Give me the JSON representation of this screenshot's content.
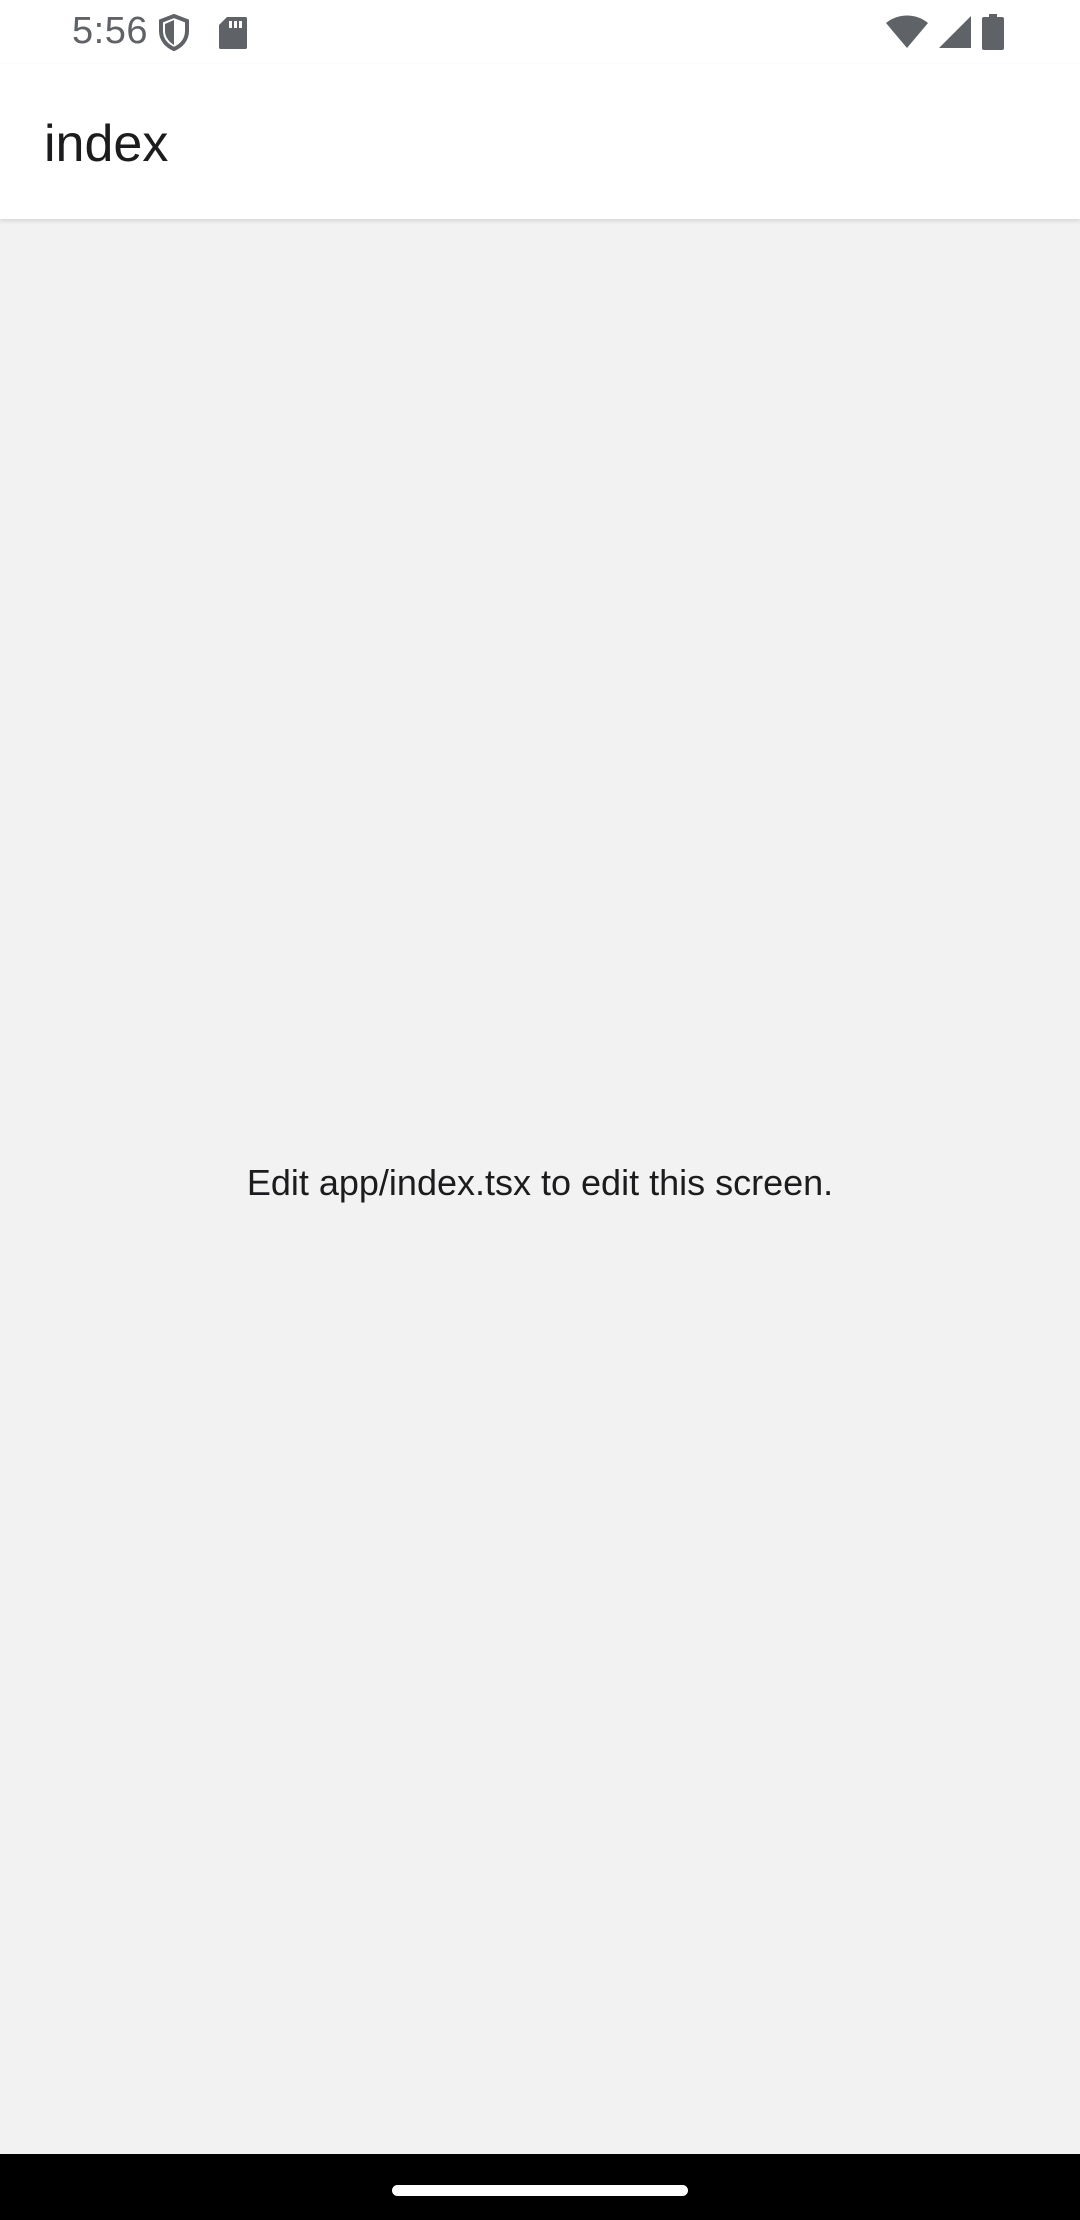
{
  "status_bar": {
    "time": "5:56",
    "left_icons": [
      "shield-icon",
      "sd-card-icon"
    ],
    "right_icons": [
      "wifi-icon",
      "cellular-signal-icon",
      "battery-icon"
    ],
    "icon_color": "#5f6368"
  },
  "app_bar": {
    "title": "index"
  },
  "content": {
    "message": "Edit app/index.tsx to edit this screen."
  },
  "colors": {
    "background": "#f2f2f2",
    "app_bar": "#ffffff",
    "nav_bar": "#000000"
  }
}
